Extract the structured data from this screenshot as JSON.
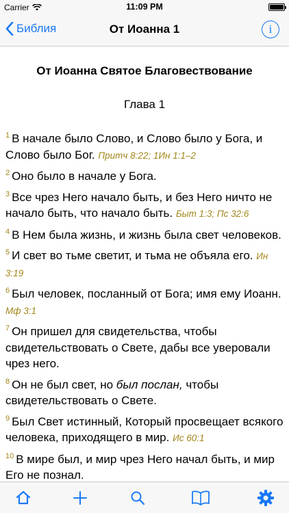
{
  "status_bar": {
    "carrier": "Carrier",
    "time": "11:09 PM"
  },
  "nav": {
    "back_label": "Библия",
    "title": "От Иоанна 1",
    "info_label": "i"
  },
  "book_title": "От Иоанна Святое Благовествование",
  "chapter_title": "Глава 1",
  "verses": [
    {
      "num": "1",
      "text": "В начале было Слово, и Слово было у Бога, и Слово было Бог.",
      "ref": "Притч 8:22; 1Ин 1:1–2"
    },
    {
      "num": "2",
      "text": "Оно было в начале у Бога."
    },
    {
      "num": "3",
      "text": "Все чрез Него начало быть, и без Него ничто не начало быть, что начало быть.",
      "ref": "Быт 1:3; Пс 32:6"
    },
    {
      "num": "4",
      "text": "В Нем была жизнь, и жизнь была свет человеков."
    },
    {
      "num": "5",
      "text": "И свет во тьме светит, и тьма не объяла его.",
      "ref": "Ин 3:19"
    },
    {
      "num": "6",
      "text": "Был человек, посланный от Бога; имя ему Иоанн.",
      "ref": "Мф 3:1"
    },
    {
      "num": "7",
      "text": "Он пришел для свидетельства, чтобы свидетельствовать о Свете, дабы все уверовали чрез него."
    },
    {
      "num": "8",
      "text_before": "Он не был свет, но ",
      "italic": "был послан,",
      "text_after": " чтобы свидетельствовать о Свете."
    },
    {
      "num": "9",
      "text": "Был Свет истинный, Который просвещает всякого человека, приходящего в мир.",
      "ref": "Ис 60:1"
    },
    {
      "num": "10",
      "text": "В мире был, и мир чрез Него начал быть, и мир Его не познал."
    }
  ],
  "tabs": [
    {
      "name": "home",
      "icon": "house-icon",
      "active": true
    },
    {
      "name": "add",
      "icon": "plus-icon",
      "active": false
    },
    {
      "name": "search",
      "icon": "magnifier-icon",
      "active": false
    },
    {
      "name": "books",
      "icon": "open-book-icon",
      "active": false
    },
    {
      "name": "settings",
      "icon": "gear-icon",
      "active": true
    }
  ],
  "colors": {
    "accent": "#1a79f6",
    "verse_number": "#a38619",
    "reference": "#a38619",
    "tab_inactive": "#8e8e93"
  }
}
